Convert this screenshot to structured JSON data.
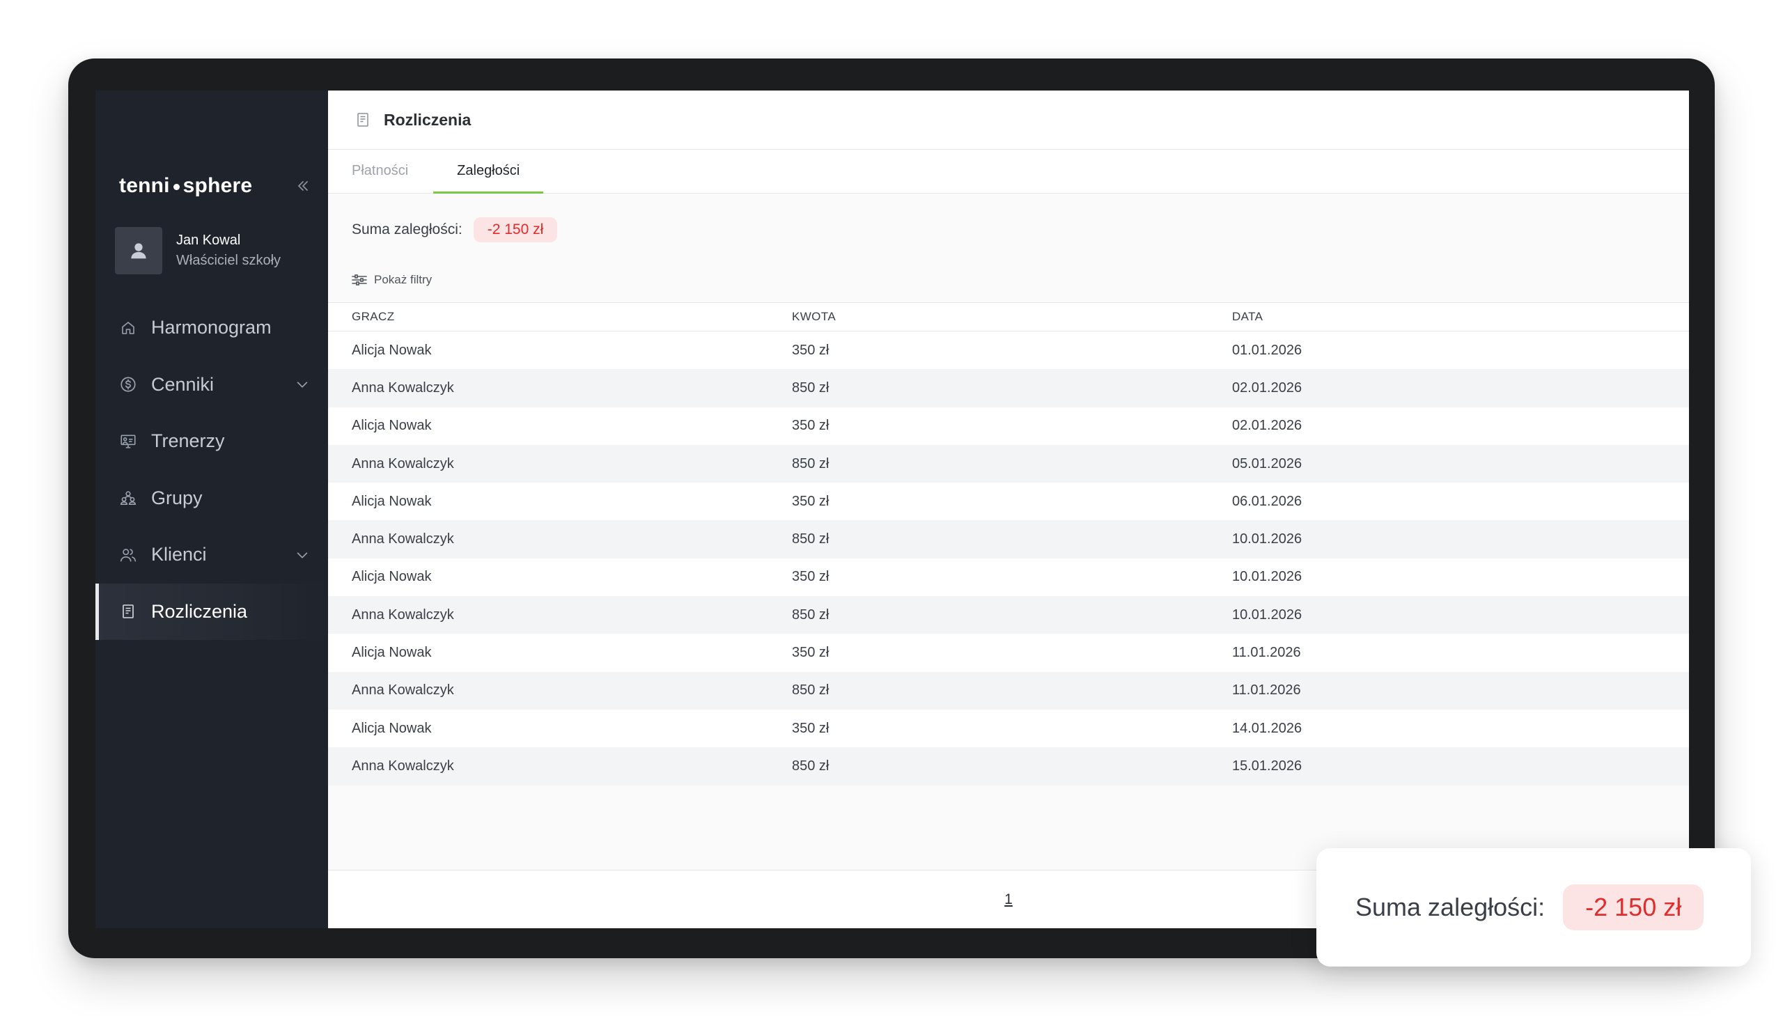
{
  "app": {
    "logo_left": "tenni",
    "logo_right": "sphere"
  },
  "user": {
    "name": "Jan Kowal",
    "role": "Właściciel szkoły"
  },
  "sidebar": {
    "items": [
      {
        "label": "Harmonogram",
        "icon": "home-icon",
        "expandable": false,
        "active": false
      },
      {
        "label": "Cenniki",
        "icon": "dollar-circle-icon",
        "expandable": true,
        "active": false
      },
      {
        "label": "Trenerzy",
        "icon": "presentation-board-icon",
        "expandable": false,
        "active": false
      },
      {
        "label": "Grupy",
        "icon": "group-icon",
        "expandable": false,
        "active": false
      },
      {
        "label": "Klienci",
        "icon": "users-icon",
        "expandable": true,
        "active": false
      },
      {
        "label": "Rozliczenia",
        "icon": "receipt-icon",
        "expandable": false,
        "active": true
      }
    ]
  },
  "header": {
    "title": "Rozliczenia"
  },
  "tabs": [
    {
      "label": "Płatności",
      "active": false
    },
    {
      "label": "Zaległości",
      "active": true
    }
  ],
  "summary": {
    "label": "Suma zaległości:",
    "value": "-2 150 zł"
  },
  "filters": {
    "label": "Pokaż filtry"
  },
  "table": {
    "columns": [
      "GRACZ",
      "KWOTA",
      "DATA"
    ],
    "rows": [
      [
        "Alicja Nowak",
        "350 zł",
        "01.01.2026"
      ],
      [
        "Anna Kowalczyk",
        "850 zł",
        "02.01.2026"
      ],
      [
        "Alicja Nowak",
        "350 zł",
        "02.01.2026"
      ],
      [
        "Anna Kowalczyk",
        "850 zł",
        "05.01.2026"
      ],
      [
        "Alicja Nowak",
        "350 zł",
        "06.01.2026"
      ],
      [
        "Anna Kowalczyk",
        "850 zł",
        "10.01.2026"
      ],
      [
        "Alicja Nowak",
        "350 zł",
        "10.01.2026"
      ],
      [
        "Anna Kowalczyk",
        "850 zł",
        "10.01.2026"
      ],
      [
        "Alicja Nowak",
        "350 zł",
        "11.01.2026"
      ],
      [
        "Anna Kowalczyk",
        "850 zł",
        "11.01.2026"
      ],
      [
        "Alicja Nowak",
        "350 zł",
        "14.01.2026"
      ],
      [
        "Anna Kowalczyk",
        "850 zł",
        "15.01.2026"
      ]
    ]
  },
  "pagination": {
    "current": "1"
  },
  "callout": {
    "label": "Suma zaległości:",
    "value": "-2 150 zł"
  },
  "colors": {
    "sidebar_bg": "#1f232b",
    "accent_green": "#7ac943",
    "negative_red": "#e02c2c",
    "negative_bg": "#fde4e4"
  }
}
